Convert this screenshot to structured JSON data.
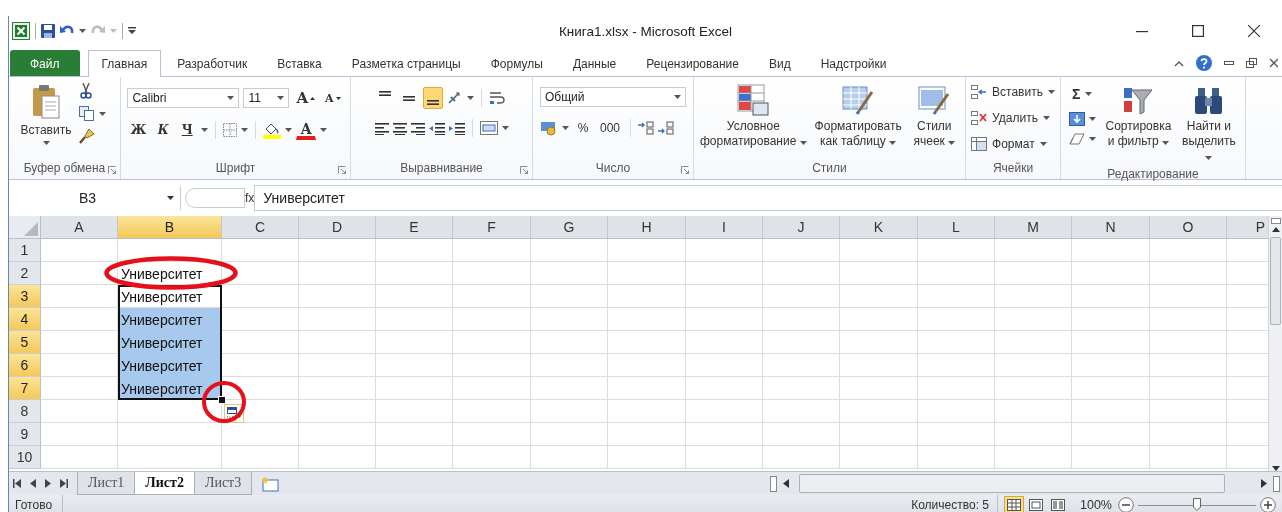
{
  "window": {
    "title": "Книга1.xlsx - Microsoft Excel"
  },
  "quick_access": [
    {
      "kind": "save",
      "disabled": false
    },
    {
      "kind": "undo",
      "disabled": false
    },
    {
      "kind": "redo",
      "disabled": true
    }
  ],
  "ribbon_tabs": [
    {
      "label": "Файл",
      "kind": "file",
      "selected": false
    },
    {
      "label": "Главная",
      "kind": "tab",
      "selected": true
    },
    {
      "label": "Разработчик",
      "kind": "tab",
      "selected": false
    },
    {
      "label": "Вставка",
      "kind": "tab",
      "selected": false
    },
    {
      "label": "Разметка страницы",
      "kind": "tab",
      "selected": false
    },
    {
      "label": "Формулы",
      "kind": "tab",
      "selected": false
    },
    {
      "label": "Данные",
      "kind": "tab",
      "selected": false
    },
    {
      "label": "Рецензирование",
      "kind": "tab",
      "selected": false
    },
    {
      "label": "Вид",
      "kind": "tab",
      "selected": false
    },
    {
      "label": "Надстройки",
      "kind": "tab",
      "selected": false
    }
  ],
  "ribbon_groups": [
    {
      "kind": "clipboard",
      "label": "Буфер обмена",
      "launcher": true,
      "paste": "Вставить"
    },
    {
      "kind": "font",
      "label": "Шрифт",
      "launcher": true,
      "font": "Calibri",
      "size": "11",
      "grow": "A",
      "shrink": "A",
      "bold": "Ж",
      "italic": "К",
      "underline": "Ч",
      "font_color": "A"
    },
    {
      "kind": "alignment",
      "label": "Выравнивание",
      "launcher": true,
      "vertical": [
        {
          "selected": false
        },
        {
          "selected": false
        },
        {
          "selected": true
        }
      ]
    },
    {
      "kind": "number",
      "label": "Число",
      "launcher": true,
      "format": "Общий",
      "percent": "%",
      "thousands": "000"
    },
    {
      "kind": "styles",
      "label": "Стили",
      "launcher": false,
      "buttons": [
        {
          "kind": "conditional",
          "label": "Условное форматирование"
        },
        {
          "kind": "table",
          "label": "Форматировать как таблицу"
        },
        {
          "kind": "cell_styles",
          "label": "Стили ячеек"
        }
      ]
    },
    {
      "kind": "cells",
      "label": "Ячейки",
      "launcher": false,
      "buttons": [
        {
          "kind": "insert",
          "label": "Вставить"
        },
        {
          "kind": "delete",
          "label": "Удалить"
        },
        {
          "kind": "format",
          "label": "Формат"
        }
      ]
    },
    {
      "kind": "editing",
      "label": "Редактирование",
      "launcher": false,
      "sum": "Σ",
      "buttons": [
        {
          "kind": "sort",
          "label": "Сортировка и фильтр"
        },
        {
          "kind": "find",
          "label": "Найти и выделить"
        }
      ]
    }
  ],
  "formula_bar": {
    "name_box": "B3",
    "fx": "fx",
    "value": "Университет"
  },
  "grid": {
    "autofill_options": true,
    "columns": [
      {
        "label": "A",
        "selected": false
      },
      {
        "label": "B",
        "selected": true
      },
      {
        "label": "C",
        "selected": false
      },
      {
        "label": "D",
        "selected": false
      },
      {
        "label": "E",
        "selected": false
      },
      {
        "label": "F",
        "selected": false
      },
      {
        "label": "G",
        "selected": false
      },
      {
        "label": "H",
        "selected": false
      },
      {
        "label": "I",
        "selected": false
      },
      {
        "label": "J",
        "selected": false
      },
      {
        "label": "K",
        "selected": false
      },
      {
        "label": "L",
        "selected": false
      },
      {
        "label": "M",
        "selected": false
      },
      {
        "label": "N",
        "selected": false
      },
      {
        "label": "O",
        "selected": false
      },
      {
        "label": "P",
        "selected": false
      }
    ],
    "rows": [
      {
        "label": "1",
        "selected": false
      },
      {
        "label": "2",
        "selected": false,
        "cell_b": {
          "text": "Университет",
          "active": false,
          "highlighted": false,
          "circled": true,
          "fill_handle": false
        }
      },
      {
        "label": "3",
        "selected": true,
        "cell_b": {
          "text": "Университет",
          "active": true,
          "highlighted": false,
          "circled": false,
          "fill_handle": false
        }
      },
      {
        "label": "4",
        "selected": true,
        "cell_b": {
          "text": "Университет",
          "active": false,
          "highlighted": true,
          "circled": false,
          "fill_handle": false
        }
      },
      {
        "label": "5",
        "selected": true,
        "cell_b": {
          "text": "Университет",
          "active": false,
          "highlighted": true,
          "circled": false,
          "fill_handle": false
        }
      },
      {
        "label": "6",
        "selected": true,
        "cell_b": {
          "text": "Университет",
          "active": false,
          "highlighted": true,
          "circled": false,
          "fill_handle": false
        }
      },
      {
        "label": "7",
        "selected": true,
        "cell_b": {
          "text": "Университет",
          "active": false,
          "highlighted": true,
          "circled": true,
          "fill_handle": true
        }
      },
      {
        "label": "8",
        "selected": false
      },
      {
        "label": "9",
        "selected": false
      },
      {
        "label": "10",
        "selected": false
      }
    ]
  },
  "sheets": [
    {
      "label": "Лист1",
      "selected": false
    },
    {
      "label": "Лист2",
      "selected": true
    },
    {
      "label": "Лист3",
      "selected": false
    }
  ],
  "status_bar": {
    "status": "Готово",
    "count": "Количество: 5",
    "views": [
      {
        "kind": "normal",
        "selected": true
      },
      {
        "kind": "page_layout",
        "selected": false
      },
      {
        "kind": "page_break",
        "selected": false
      }
    ],
    "zoom": "100%",
    "zoom_slider": {
      "level": 0.5
    }
  }
}
